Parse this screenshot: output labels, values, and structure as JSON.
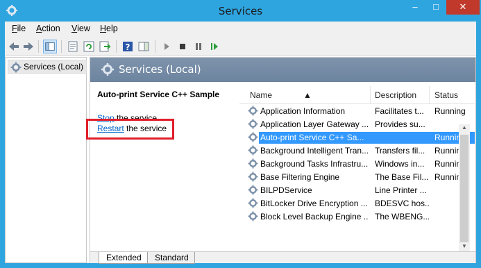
{
  "window": {
    "title": "Services",
    "minimize": "–",
    "maximize": "□",
    "close": "✕"
  },
  "menu": {
    "file": {
      "key": "F",
      "rest": "ile"
    },
    "action": {
      "key": "A",
      "rest": "ction"
    },
    "view": {
      "key": "V",
      "rest": "iew"
    },
    "help": {
      "key": "H",
      "rest": "elp"
    }
  },
  "toolbar": {
    "icons": [
      "back-icon",
      "forward-icon",
      "show-hide-console-tree-icon",
      "properties-icon",
      "refresh-icon",
      "export-list-icon",
      "help-icon",
      "show-hide-action-pane-icon",
      "start-service-icon",
      "stop-service-icon",
      "pause-service-icon",
      "resume-service-icon"
    ]
  },
  "tree": {
    "item": "Services (Local)"
  },
  "header": {
    "title": "Services (Local)"
  },
  "details": {
    "service_name": "Auto-print Service C++ Sample",
    "stop_link": "Stop",
    "stop_rest": " the service",
    "restart_link": "Restart",
    "restart_rest": " the service"
  },
  "list": {
    "columns": [
      "Name",
      "Description",
      "Status"
    ],
    "rows": [
      {
        "name": "Application Information",
        "description": "Facilitates t...",
        "status": "Running"
      },
      {
        "name": "Application Layer Gateway ...",
        "description": "Provides su...",
        "status": ""
      },
      {
        "name": "Auto-print Service C++ Sa...",
        "description": "",
        "status": "Running",
        "selected": true
      },
      {
        "name": "Background Intelligent Tran...",
        "description": "Transfers fil...",
        "status": "Running"
      },
      {
        "name": "Background Tasks Infrastru...",
        "description": "Windows in...",
        "status": "Running"
      },
      {
        "name": "Base Filtering Engine",
        "description": "The Base Fil...",
        "status": "Running"
      },
      {
        "name": "BILPDService",
        "description": "Line Printer ...",
        "status": ""
      },
      {
        "name": "BitLocker Drive Encryption ...",
        "description": "BDESVC hos...",
        "status": ""
      },
      {
        "name": "Block Level Backup Engine ...",
        "description": "The WBENG...",
        "status": ""
      }
    ]
  },
  "tabs": {
    "extended": "Extended",
    "standard": "Standard"
  },
  "colors": {
    "titlebar": "#2fa5e0",
    "header": "#7289a6",
    "selection": "#3399ff",
    "link": "#0066cc",
    "highlight_box": "#e01e2a"
  }
}
